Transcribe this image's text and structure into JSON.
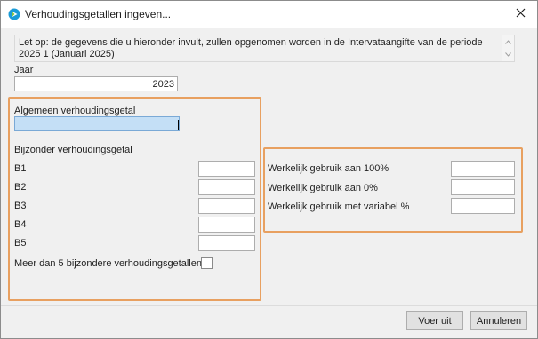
{
  "window": {
    "title": "Verhoudingsgetallen ingeven...",
    "close_label": "✕"
  },
  "notice": {
    "text": "Let op: de gegevens die u hieronder invult, zullen opgenomen worden in de Intervataangifte van de periode 2025 1 (Januari 2025)"
  },
  "year": {
    "label": "Jaar",
    "value": "2023"
  },
  "general": {
    "label": "Algemeen verhoudingsgetal",
    "value": ""
  },
  "special": {
    "heading": "Bijzonder verhoudingsgetal",
    "items": [
      {
        "label": "B1",
        "value": ""
      },
      {
        "label": "B2",
        "value": ""
      },
      {
        "label": "B3",
        "value": ""
      },
      {
        "label": "B4",
        "value": ""
      },
      {
        "label": "B5",
        "value": ""
      }
    ],
    "more_label": "Meer dan 5 bijzondere verhoudingsgetallen",
    "more_checked": false
  },
  "usage": {
    "items": [
      {
        "label": "Werkelijk gebruik aan 100%",
        "value": ""
      },
      {
        "label": "Werkelijk gebruik aan 0%",
        "value": ""
      },
      {
        "label": "Werkelijk gebruik met variabel %",
        "value": ""
      }
    ]
  },
  "buttons": {
    "ok": "Voer uit",
    "cancel": "Annuleren"
  },
  "colors": {
    "highlight_border": "#e8a060",
    "active_field": "#c4dff6",
    "window_bg": "#f0f0f0"
  }
}
